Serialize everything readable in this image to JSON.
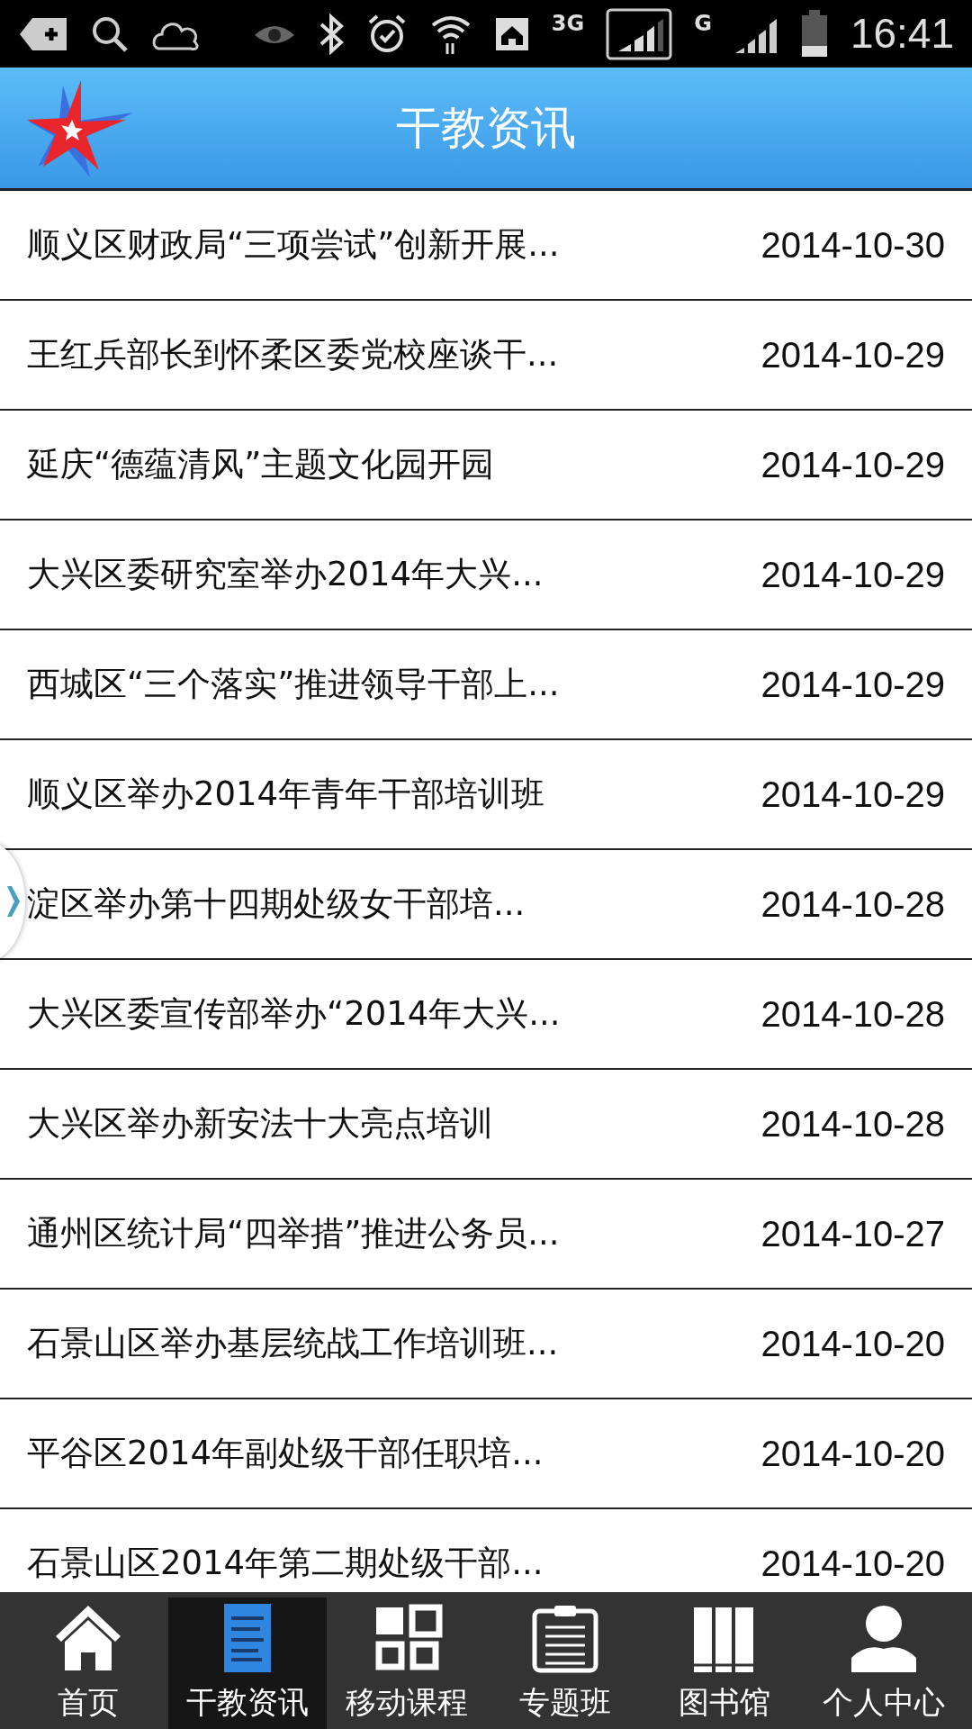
{
  "status_bar": {
    "network_label": "3G",
    "network2_label": "G",
    "time": "16:41"
  },
  "header": {
    "title": "干教资讯"
  },
  "news": [
    {
      "title": "顺义区财政局“三项尝试”创新开展...",
      "date": "2014-10-30"
    },
    {
      "title": "王红兵部长到怀柔区委党校座谈干...",
      "date": "2014-10-29"
    },
    {
      "title": "延庆“德蕴清风”主题文化园开园",
      "date": "2014-10-29"
    },
    {
      "title": "大兴区委研究室举办2014年大兴...",
      "date": "2014-10-29"
    },
    {
      "title": "西城区“三个落实”推进领导干部上...",
      "date": "2014-10-29"
    },
    {
      "title": "顺义区举办2014年青年干部培训班",
      "date": "2014-10-29"
    },
    {
      "title": "淀区举办第十四期处级女干部培...",
      "date": "2014-10-28"
    },
    {
      "title": "大兴区委宣传部举办“2014年大兴...",
      "date": "2014-10-28"
    },
    {
      "title": "大兴区举办新安法十大亮点培训",
      "date": "2014-10-28"
    },
    {
      "title": "通州区统计局“四举措”推进公务员...",
      "date": "2014-10-27"
    },
    {
      "title": "石景山区举办基层统战工作培训班...",
      "date": "2014-10-20"
    },
    {
      "title": "平谷区2014年副处级干部任职培...",
      "date": "2014-10-20"
    },
    {
      "title": "石景山区2014年第二期处级干部...",
      "date": "2014-10-20"
    }
  ],
  "tabs": [
    {
      "label": "首页",
      "kind": "home",
      "selected": false
    },
    {
      "label": "干教资讯",
      "kind": "news",
      "selected": true
    },
    {
      "label": "移动课程",
      "kind": "grid",
      "selected": false
    },
    {
      "label": "专题班",
      "kind": "clipboard",
      "selected": false
    },
    {
      "label": "图书馆",
      "kind": "books",
      "selected": false
    },
    {
      "label": "个人中心",
      "kind": "person",
      "selected": false
    }
  ]
}
